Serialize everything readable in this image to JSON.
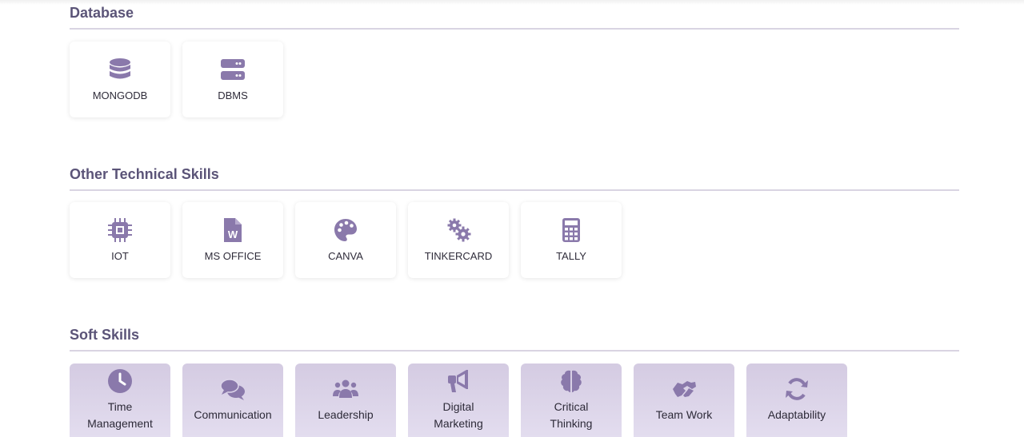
{
  "colors": {
    "accent": "#8a79ab",
    "heading": "#5b5478",
    "divider": "#d9d4e2",
    "soft_card": "#dcd5e8"
  },
  "sections": [
    {
      "title": "Database",
      "items": [
        {
          "label": "MONGODB",
          "icon": "database-icon"
        },
        {
          "label": "DBMS",
          "icon": "server-icon"
        }
      ]
    },
    {
      "title": "Other Technical Skills",
      "items": [
        {
          "label": "IOT",
          "icon": "microchip-icon"
        },
        {
          "label": "MS OFFICE",
          "icon": "word-file-icon"
        },
        {
          "label": "CANVA",
          "icon": "palette-icon"
        },
        {
          "label": "TINKERCARD",
          "icon": "gears-icon"
        },
        {
          "label": "TALLY",
          "icon": "calculator-icon"
        }
      ]
    },
    {
      "title": "Soft Skills",
      "items": [
        {
          "label_line1": "Time",
          "label_line2": "Management",
          "icon": "clock-icon"
        },
        {
          "label": "Communication",
          "icon": "comments-icon"
        },
        {
          "label": "Leadership",
          "icon": "users-icon"
        },
        {
          "label_line1": "Digital",
          "label_line2": "Marketing",
          "icon": "bullhorn-icon"
        },
        {
          "label_line1": "Critical",
          "label_line2": "Thinking",
          "icon": "brain-icon"
        },
        {
          "label": "Team Work",
          "icon": "handshake-icon"
        },
        {
          "label": "Adaptability",
          "icon": "sync-icon"
        }
      ]
    }
  ]
}
